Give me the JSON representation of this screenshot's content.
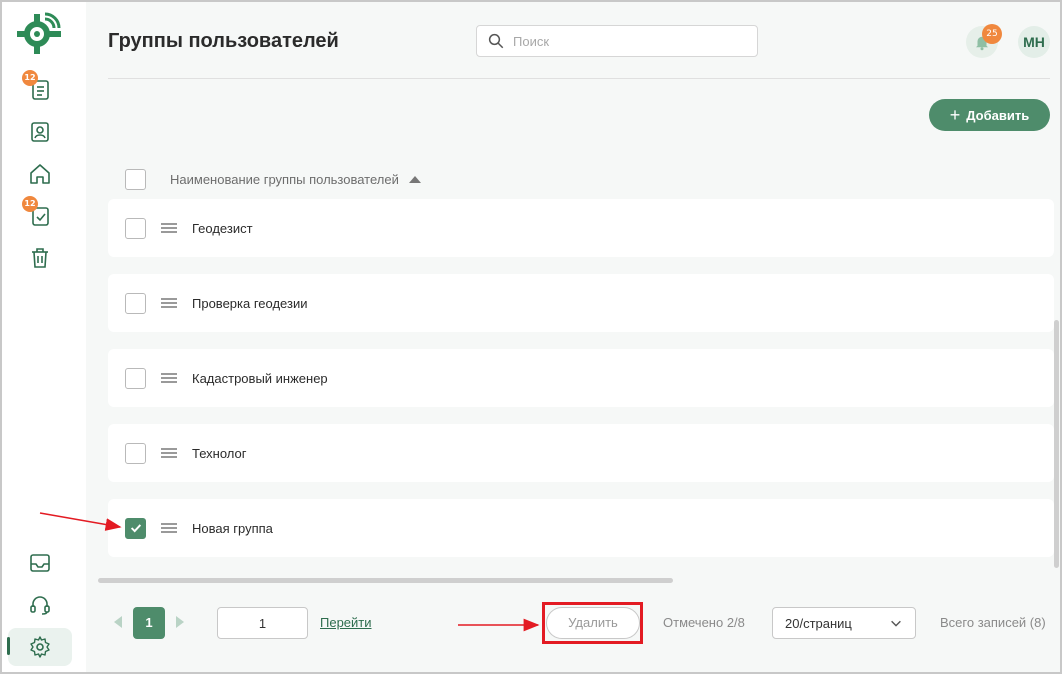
{
  "header": {
    "title": "Группы пользователей",
    "search_placeholder": "Поиск",
    "notifications_count": "25",
    "avatar_initials": "МН"
  },
  "sidebar": {
    "items": [
      {
        "icon": "document-list-icon",
        "badge": "12"
      },
      {
        "icon": "contact-card-icon",
        "badge": ""
      },
      {
        "icon": "home-icon",
        "badge": ""
      },
      {
        "icon": "task-check-icon",
        "badge": "12"
      },
      {
        "icon": "trash-icon",
        "badge": ""
      },
      {
        "icon": "inbox-icon",
        "badge": ""
      },
      {
        "icon": "headset-icon",
        "badge": ""
      },
      {
        "icon": "gear-icon",
        "badge": "",
        "active": true
      }
    ]
  },
  "toolbar": {
    "add_label": "Добавить"
  },
  "table": {
    "column_header": "Наименование группы пользователей",
    "sort": "ascending",
    "rows": [
      {
        "label": "Геодезист",
        "checked": false
      },
      {
        "label": "Проверка геодезии",
        "checked": false
      },
      {
        "label": "Кадастровый инженер",
        "checked": false
      },
      {
        "label": "Технолог",
        "checked": false
      },
      {
        "label": "Новая группа",
        "checked": true
      }
    ]
  },
  "footer": {
    "current_page": "1",
    "page_input_value": "1",
    "goto_label": "Перейти",
    "delete_label": "Удалить",
    "selected_text": "Отмечено 2/8",
    "per_page_value": "20/страниц",
    "total_text": "Всего записей (8)"
  },
  "colors": {
    "accent": "#4e8c6b",
    "badge": "#f0883e",
    "annotation": "#e31b23"
  }
}
